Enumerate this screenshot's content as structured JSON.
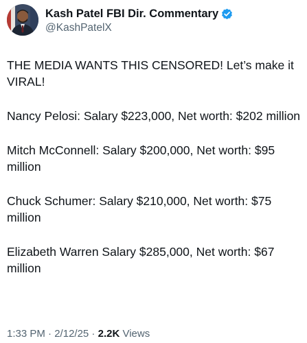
{
  "author": {
    "display_name": "Kash Patel FBI Dir. Commentary",
    "handle": "@KashPatelX",
    "verified_color": "#1d9bf0",
    "avatar_icon": "profile-photo"
  },
  "tweet": {
    "paragraphs": [
      "THE MEDIA WANTS THIS CENSORED! Let’s make it VIRAL!",
      "Nancy Pelosi: Salary $223,000, Net worth: $202 million",
      "Mitch McConnell: Salary $200,000, Net worth: $95 million",
      "Chuck Schumer: Salary $210,000, Net worth: $75 million",
      "Elizabeth Warren Salary $285,000, Net worth: $67 million"
    ]
  },
  "meta": {
    "time": "1:33 PM",
    "separator": " · ",
    "date": "2/12/25",
    "views_count": "2.2K",
    "views_label": " Views"
  }
}
